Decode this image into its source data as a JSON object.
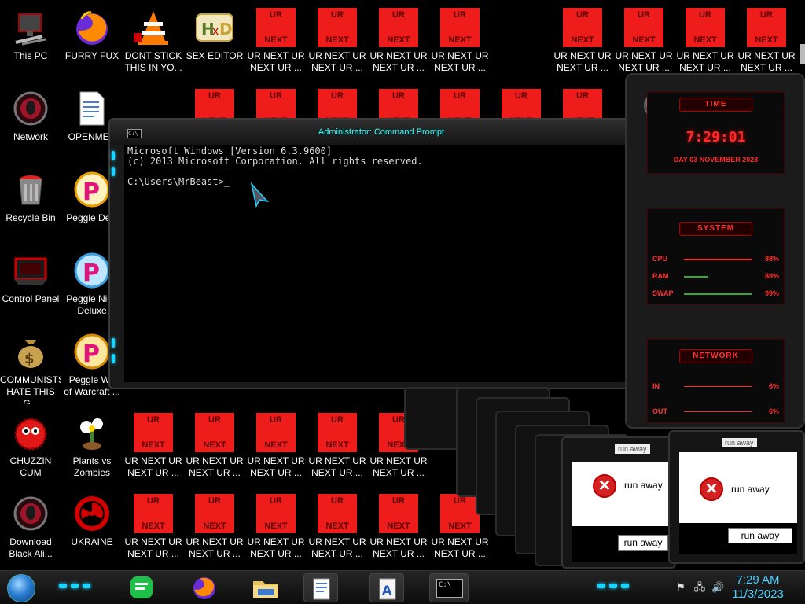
{
  "desktop_icons": [
    {
      "name": "this-pc",
      "label": "This PC",
      "icon": "computer-icon"
    },
    {
      "name": "furry-fux",
      "label": "FURRY FUX",
      "icon": "firefox-icon"
    },
    {
      "name": "dont-stick",
      "label": "DONT STICK",
      "label2": "THIS IN YO...",
      "icon": "vlc-icon"
    },
    {
      "name": "sex-editor",
      "label": "SEX EDITOR",
      "icon": "hxd-icon"
    },
    {
      "name": "network",
      "label": "Network",
      "icon": "alien-globe-icon"
    },
    {
      "name": "openmec",
      "label": "OPENMEC",
      "icon": "document-icon"
    },
    {
      "name": "recycle-bin",
      "label": "Recycle Bin",
      "icon": "recycle-bin-icon"
    },
    {
      "name": "peggle-deluxe",
      "label": "Peggle Delu",
      "icon": "peggle-icon"
    },
    {
      "name": "control-panel",
      "label": "Control Panel",
      "icon": "control-panel-icon"
    },
    {
      "name": "peggle-nights",
      "label": "Peggle Nigh",
      "label2": "Deluxe",
      "icon": "peggle-icon"
    },
    {
      "name": "communists",
      "label": "COMMUNISTS",
      "label2": "HATE THIS G...",
      "icon": "money-bag-icon"
    },
    {
      "name": "peggle-world",
      "label": "Peggle Wo",
      "label2": "of Warcraft ...",
      "icon": "peggle-icon"
    },
    {
      "name": "chuzzin-cum",
      "label": "CHUZZIN",
      "label2": "CUM",
      "icon": "chuzzle-icon"
    },
    {
      "name": "plants-vs-zombies",
      "label": "Plants vs",
      "label2": "Zombies",
      "icon": "plant-icon"
    },
    {
      "name": "download-black-ali",
      "label": "Download",
      "label2": "Black Ali...",
      "icon": "alien-globe-icon"
    },
    {
      "name": "ukraine",
      "label": "UKRAINE",
      "icon": "radiation-icon"
    }
  ],
  "ur_tile": {
    "top_text": "UR",
    "bottom_text": "NEXT",
    "label1": "UR NEXT UR",
    "label2": "NEXT UR ..."
  },
  "cmd": {
    "title": "Administrator: Command Prompt",
    "icon_text": "C:\\",
    "line1": "Microsoft Windows [Version 6.3.9600]",
    "line2": "(c) 2013 Microsoft Corporation. All rights reserved.",
    "prompt": "C:\\Users\\MrBeast>"
  },
  "gadget": {
    "time_header": "TIME",
    "time": "7:29:01",
    "date": "DAY 03 NOVEMBER 2023",
    "system_header": "SYSTEM",
    "rows": [
      {
        "label": "CPU",
        "value": "88%"
      },
      {
        "label": "RAM",
        "value": "88%"
      },
      {
        "label": "SWAP",
        "value": "99%"
      }
    ],
    "network_header": "NETWORK",
    "net_rows": [
      {
        "label": "IN",
        "value": "6%"
      },
      {
        "label": "OUT",
        "value": "6%"
      }
    ]
  },
  "popups": {
    "title": "run away",
    "message": "run away",
    "button": "run away"
  },
  "taskbar": {
    "time": "7:29 AM",
    "date": "11/3/2023",
    "cmd_icon_text": "C:\\"
  },
  "colors": {
    "accent": "#1cd4ff",
    "tile_red": "#ef1c1c",
    "gadget_red": "#ff2a2a"
  }
}
